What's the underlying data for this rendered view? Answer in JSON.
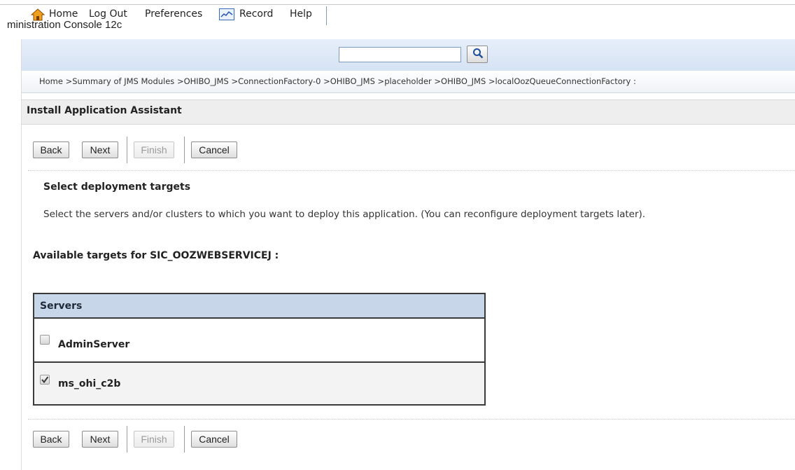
{
  "app": {
    "title": "ministration Console 12c"
  },
  "toolbar": {
    "home_label": "Home",
    "logout_label": "Log Out",
    "preferences_label": "Preferences",
    "record_label": "Record",
    "help_label": "Help",
    "search_value": "",
    "icons": {
      "home": "home-icon",
      "record": "record-icon",
      "search": "search-icon"
    }
  },
  "breadcrumb": {
    "text": "Home >Summary of JMS Modules >OHIBO_JMS >ConnectionFactory-0 >OHIBO_JMS >placeholder >OHIBO_JMS >localOozQueueConnectionFactory :"
  },
  "panel": {
    "title": "Install Application Assistant"
  },
  "buttons": {
    "back": "Back",
    "next": "Next",
    "finish": "Finish",
    "cancel": "Cancel"
  },
  "section": {
    "heading": "Select deployment targets",
    "description": "Select the servers and/or clusters to which you want to deploy this application. (You can reconfigure deployment targets later)."
  },
  "targets": {
    "label": "Available targets for SIC_OOZWEBSERVICEJ :",
    "column_header": "Servers",
    "servers": [
      {
        "name": "AdminServer",
        "checked": false
      },
      {
        "name": "ms_ohi_c2b",
        "checked": true
      }
    ]
  },
  "colors": {
    "toolbar_bg": "#dce7f6",
    "table_header_bg": "#c8d6ea",
    "panel_header_bg": "#eeeeee"
  }
}
